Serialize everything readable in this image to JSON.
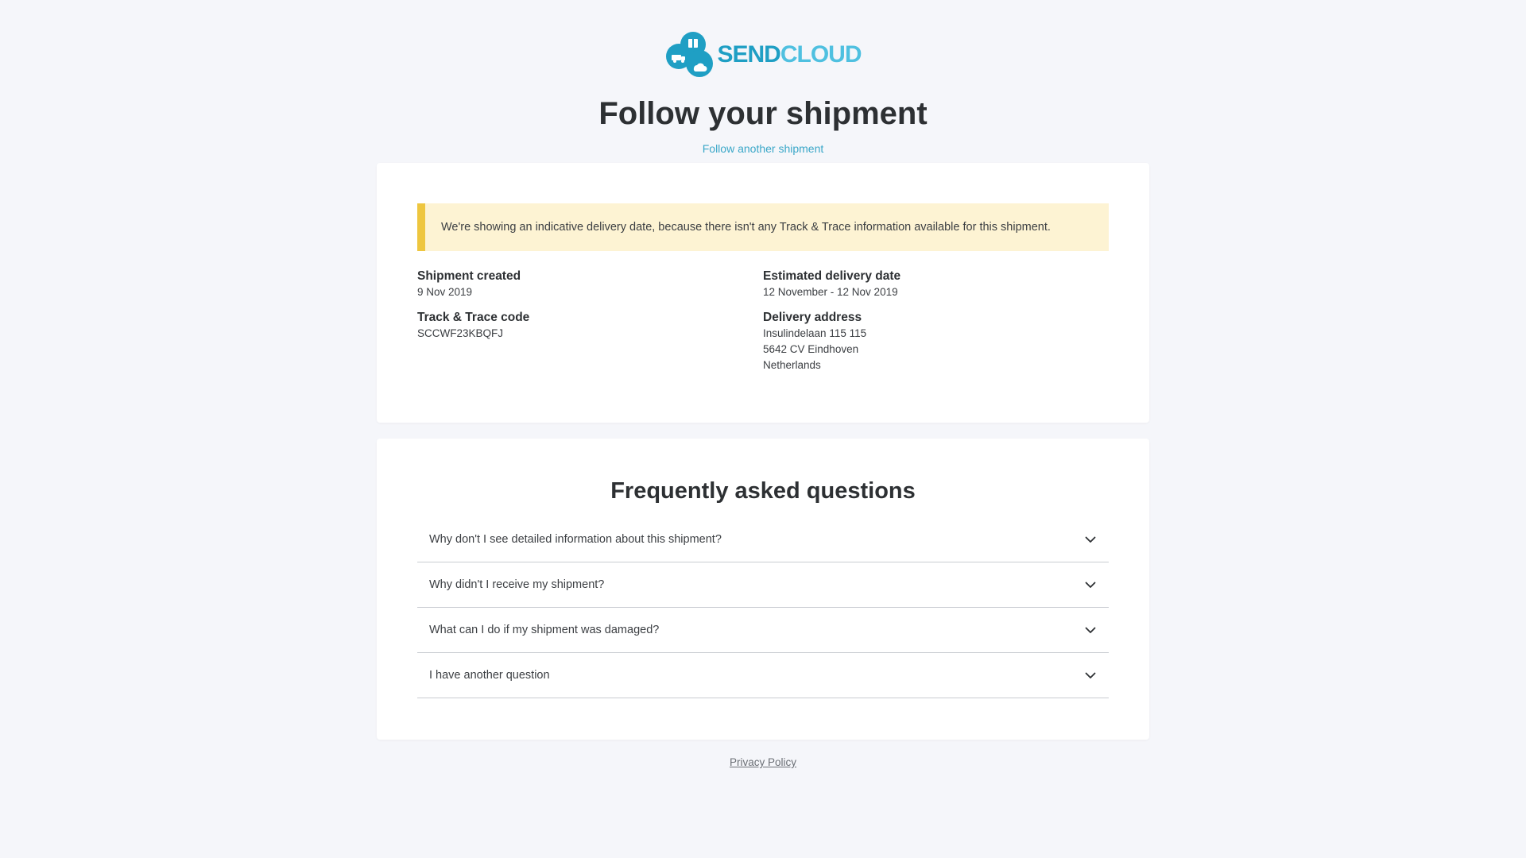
{
  "brand": {
    "name_part1": "SEND",
    "name_part2": "CLOUD",
    "color_primary": "#1f9fc4",
    "color_secondary": "#4fc0e0"
  },
  "header": {
    "title": "Follow your shipment",
    "follow_another_link": "Follow another shipment"
  },
  "notice": {
    "text": "We're showing an indicative delivery date, because there isn't any Track & Trace information available for this shipment.",
    "accent_color": "#eec63f"
  },
  "shipment": {
    "created_label": "Shipment created",
    "created_value": "9 Nov 2019",
    "tracking_label": "Track & Trace code",
    "tracking_value": "SCCWF23KBQFJ",
    "estimated_label": "Estimated delivery date",
    "estimated_value": "12 November - 12 Nov 2019",
    "address_label": "Delivery address",
    "address_lines": [
      "Insulindelaan 115 115",
      "5642 CV Eindhoven",
      "Netherlands"
    ]
  },
  "faq": {
    "title": "Frequently asked questions",
    "items": [
      {
        "question": "Why don't I see detailed information about this shipment?",
        "icon": "chevron-down-icon"
      },
      {
        "question": "Why didn't I receive my shipment?",
        "icon": "chevron-down-icon"
      },
      {
        "question": "What can I do if my shipment was damaged?",
        "icon": "chevron-down-icon"
      },
      {
        "question": "I have another question",
        "icon": "chevron-down-icon"
      }
    ]
  },
  "footer": {
    "privacy_link": "Privacy Policy"
  }
}
